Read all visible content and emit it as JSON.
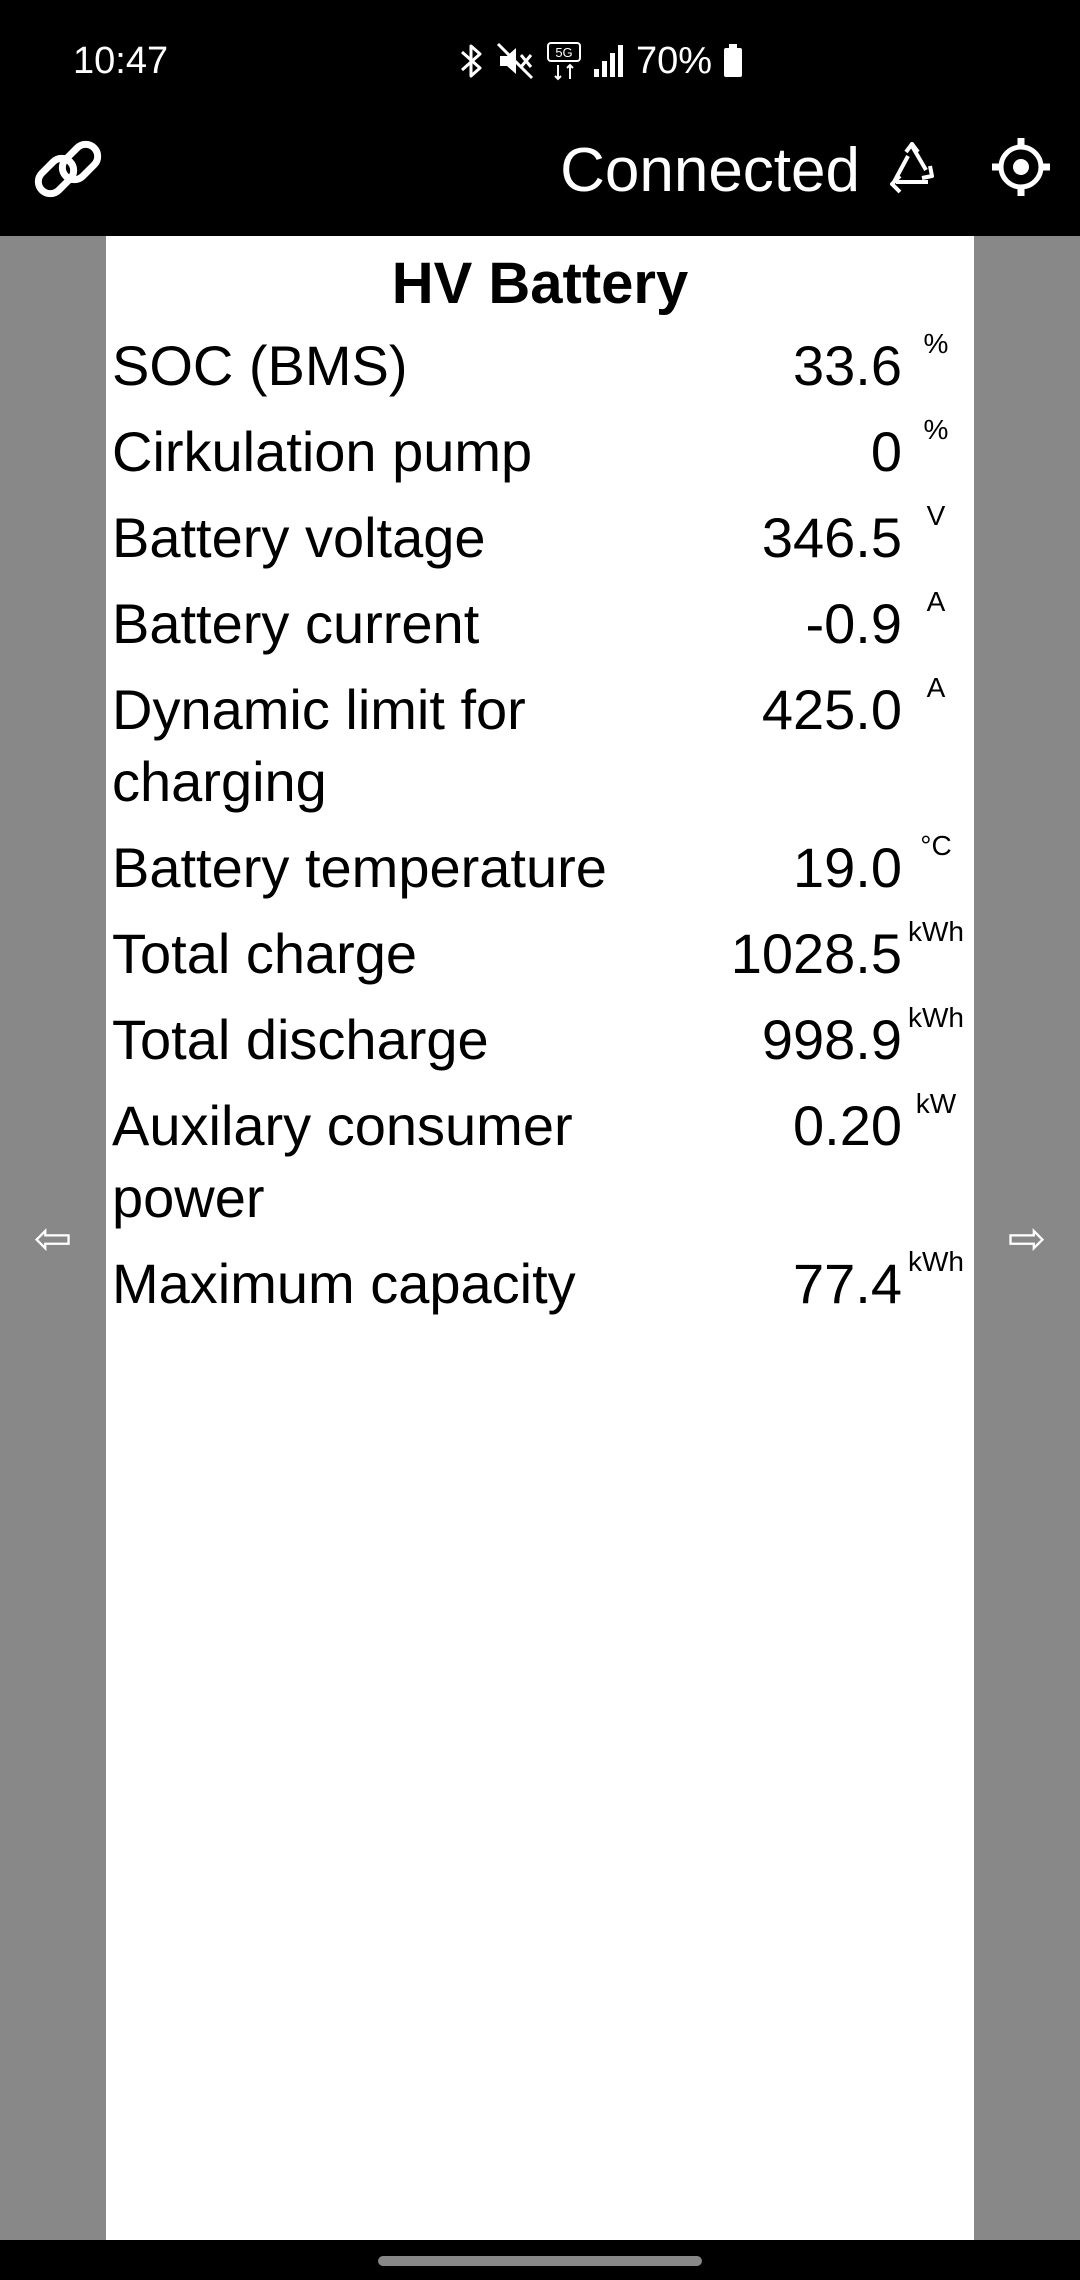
{
  "status_bar": {
    "time": "10:47",
    "battery_pct": "70%",
    "icons": [
      "bluetooth-icon",
      "mute-icon",
      "5g-icon",
      "signal-icon",
      "battery-icon"
    ]
  },
  "app_bar": {
    "link_icon": "link-icon",
    "status": "Connected",
    "recycle_icon": "recycle-icon",
    "settings_icon": "settings-icon"
  },
  "panel": {
    "title": "HV Battery",
    "rows": [
      {
        "label": "SOC (BMS)",
        "value": "33.6",
        "unit": "%"
      },
      {
        "label": "Cirkulation pump",
        "value": "0",
        "unit": "%"
      },
      {
        "label": "Battery voltage",
        "value": "346.5",
        "unit": "V"
      },
      {
        "label": "Battery current",
        "value": "-0.9",
        "unit": "A"
      },
      {
        "label": "Dynamic limit for charging",
        "value": "425.0",
        "unit": "A"
      },
      {
        "label": "Battery temperature",
        "value": "19.0",
        "unit": "°C"
      },
      {
        "label": "Total charge",
        "value": "1028.5",
        "unit": "kWh"
      },
      {
        "label": "Total discharge",
        "value": "998.9",
        "unit": "kWh"
      },
      {
        "label": "Auxilary consumer power",
        "value": "0.20",
        "unit": "kW"
      },
      {
        "label": "Maximum capacity",
        "value": "77.4",
        "unit": "kWh"
      }
    ]
  },
  "nav": {
    "prev": "⇦",
    "next": "⇨"
  },
  "colors": {
    "background": "#000000",
    "side_gutter": "#888888",
    "panel": "#ffffff",
    "text": "#000000"
  }
}
